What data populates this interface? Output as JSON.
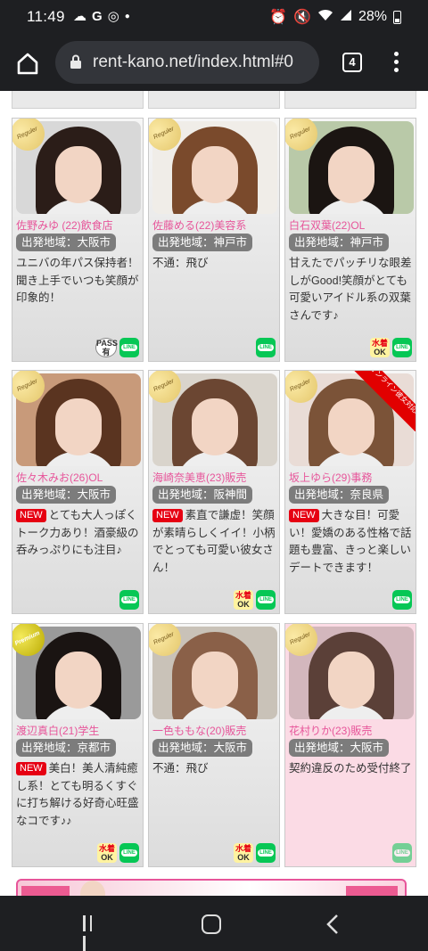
{
  "status_bar": {
    "time": "11:49",
    "battery": "28%",
    "left_icons": [
      "cloud-icon",
      "google-icon",
      "chrome-icon",
      "dot-icon"
    ],
    "right_icons": [
      "alarm-icon",
      "mute-icon",
      "wifi-icon",
      "signal-icon",
      "battery-icon"
    ]
  },
  "browser": {
    "url": "rent-kano.net/index.html#0",
    "tab_count": "4"
  },
  "cards": [
    {
      "name": "佐野みゆ (22)飲食店",
      "area": "出発地域：大阪市",
      "rank": "Reguler",
      "new": false,
      "desc": "ユニバの年パス保持者！聞き上手でいつも笑顔が印象的！",
      "badges": [
        "pass",
        "line"
      ],
      "pass_label": "PASS",
      "pass_sub": "有"
    },
    {
      "name": "佐藤める(22)美容系",
      "area": "出発地域：神戸市",
      "rank": "Reguler",
      "new": false,
      "desc": "不通：飛び",
      "badges": [
        "line"
      ]
    },
    {
      "name": "白石双葉(22)OL",
      "area": "出発地域：神戸市",
      "rank": "Reguler",
      "new": false,
      "desc": "甘えたでパッチリな眼差しがGood!笑顔がとても可愛いアイドル系の双葉さんです♪",
      "badges": [
        "mizugi",
        "line"
      ]
    },
    {
      "name": "佐々木みお(26)OL",
      "area": "出発地域：大阪市",
      "rank": "Reguler",
      "new": true,
      "desc": "とても大人っぽくトーク力あり！酒豪級の呑みっぷりにも注目♪",
      "badges": [
        "line"
      ]
    },
    {
      "name": "海崎奈美恵(23)販売",
      "area": "出発地域：阪神間",
      "rank": "Reguler",
      "new": true,
      "desc": "素直で謙虚！笑顔が素晴らしくイイ！小柄でとっても可愛い彼女さん！",
      "badges": [
        "mizugi",
        "line"
      ]
    },
    {
      "name": "坂上ゆら(29)事務",
      "area": "出発地域：奈良県",
      "rank": "Reguler",
      "new": true,
      "desc": "大きな目！可愛い！愛嬌のある性格で話題も豊富、きっと楽しいデートできます！",
      "badges": [
        "line"
      ],
      "ribbon": "オンライン彼女対応"
    },
    {
      "name": "渡辺真白(21)学生",
      "area": "出発地域：京都市",
      "rank": "Premium",
      "new": true,
      "desc": "美白！美人清純癒し系！とても明るくすぐに打ち解ける好奇心旺盛なコです♪♪",
      "badges": [
        "mizugi",
        "line"
      ]
    },
    {
      "name": "一色ももな(20)販売",
      "area": "出発地域：大阪市",
      "rank": "Reguler",
      "new": false,
      "desc": "不通：飛び",
      "badges": [
        "mizugi",
        "line"
      ]
    },
    {
      "name": "花村りか(23)販売",
      "area": "出発地域：大阪市",
      "rank": "Reguler",
      "new": false,
      "desc": "契約違反のため受付終了",
      "badges": [
        "line"
      ],
      "closed": true
    }
  ],
  "badge_text": {
    "new": "NEW",
    "mizugi_top": "水着",
    "mizugi_bottom": "OK",
    "line": "LINE"
  },
  "photo_colors": [
    [
      "#2b1d18",
      "#d8d8d8"
    ],
    [
      "#7a4a2c",
      "#f0ede8"
    ],
    [
      "#1b1512",
      "#b9c9a8"
    ],
    [
      "#5a3420",
      "#c89a7a"
    ],
    [
      "#6b4632",
      "#d9d4cc"
    ],
    [
      "#7b5338",
      "#e9dcd6"
    ],
    [
      "#1a1412",
      "#9a9a9a"
    ],
    [
      "#8a6048",
      "#c9c2b8"
    ],
    [
      "#5b4038",
      "#d3b7bd"
    ]
  ]
}
